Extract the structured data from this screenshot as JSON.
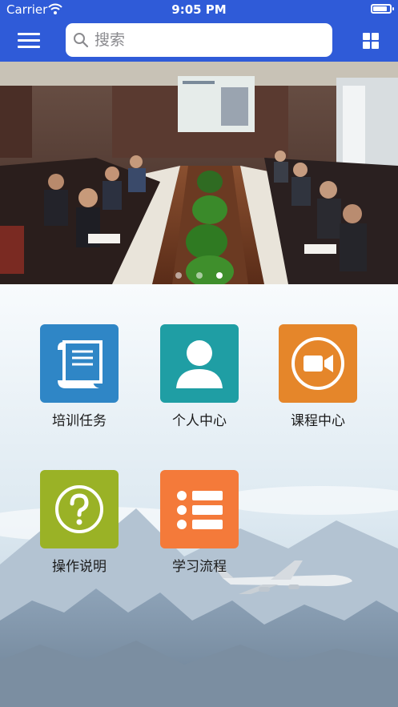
{
  "status_bar": {
    "carrier": "Carrier",
    "time": "9:05 PM"
  },
  "nav": {
    "search_placeholder": "搜索"
  },
  "banner": {
    "slide_count": 3,
    "active_slide": 3
  },
  "menu": [
    {
      "label": "培训任务",
      "icon": "scroll-document-icon",
      "color": "#2f86c6"
    },
    {
      "label": "个人中心",
      "icon": "person-icon",
      "color": "#1f9ea4"
    },
    {
      "label": "课程中心",
      "icon": "video-camera-icon",
      "color": "#e5862a"
    },
    {
      "label": "操作说明",
      "icon": "question-mark-icon",
      "color": "#9ab226"
    },
    {
      "label": "学习流程",
      "icon": "list-icon",
      "color": "#f47a3a"
    }
  ],
  "colors": {
    "nav": "#2f5bd8"
  }
}
